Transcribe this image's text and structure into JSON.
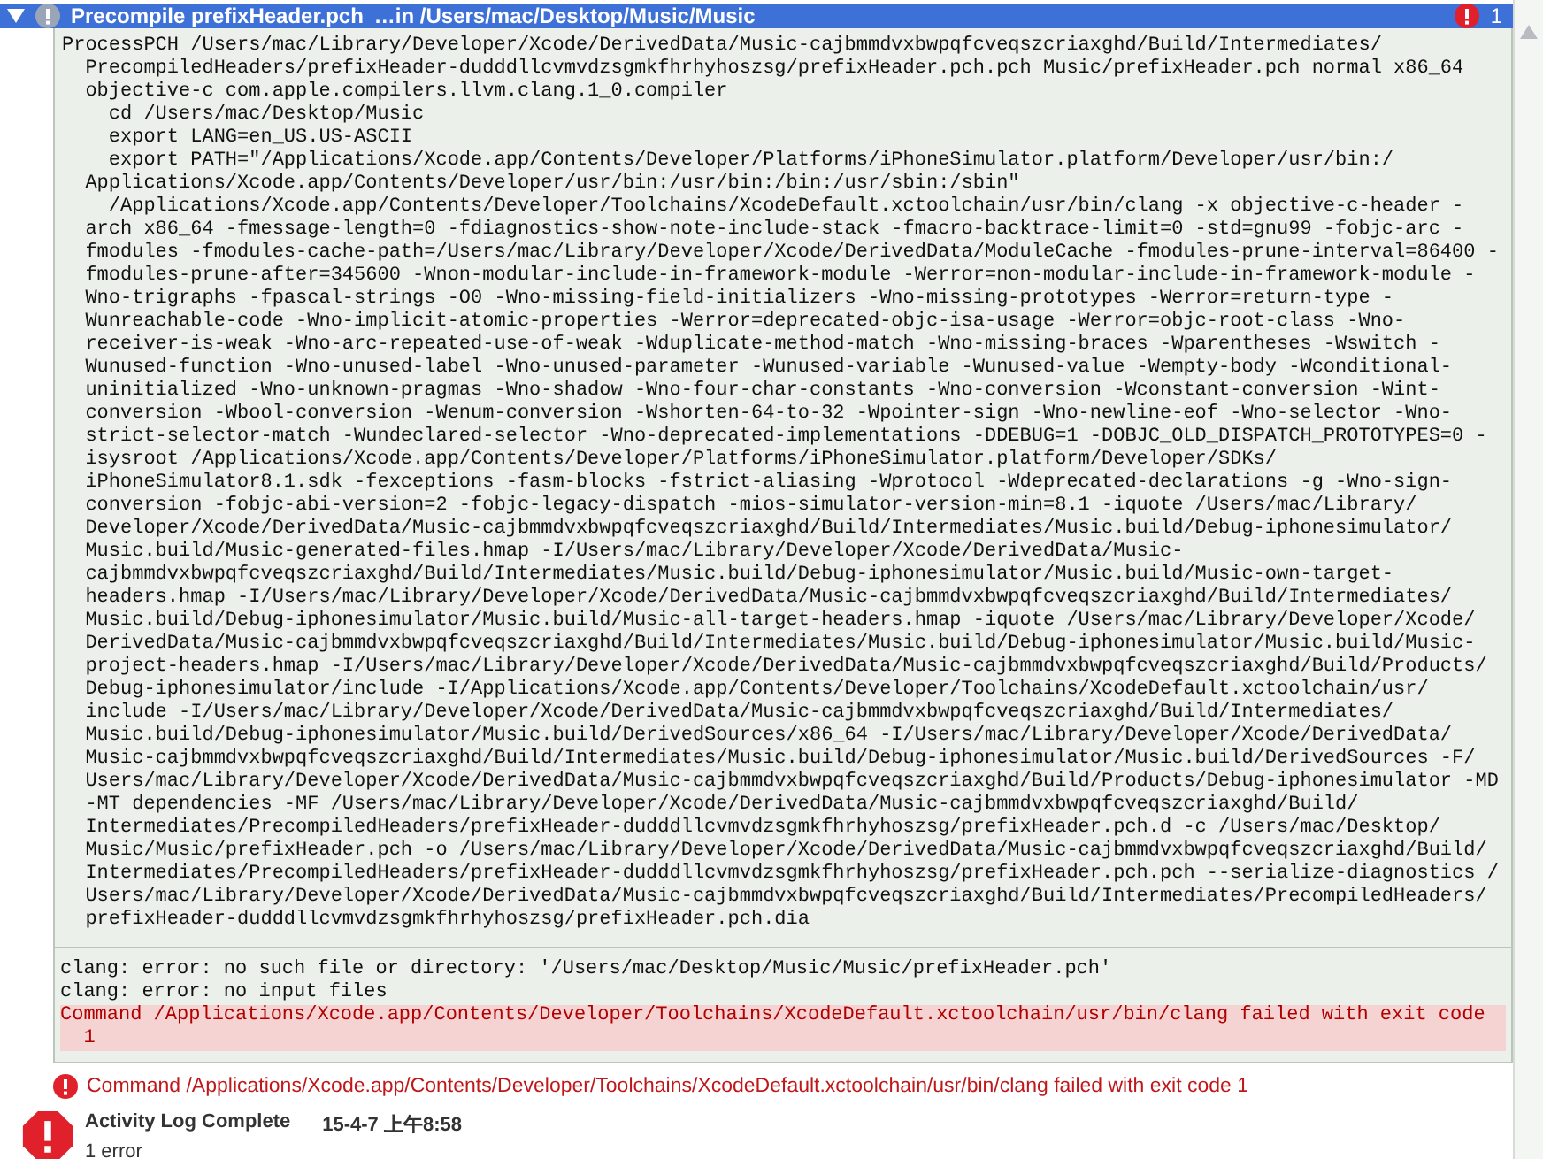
{
  "header": {
    "expanded": true,
    "title": "Precompile prefixHeader.pch",
    "subtitle": "…in /Users/mac/Desktop/Music/Music",
    "error_count": "1"
  },
  "log_lines": [
    "ProcessPCH /Users/mac/Library/Developer/Xcode/DerivedData/Music-cajbmmdvxbwpqfcveqszcriaxghd/Build/Intermediates/",
    "  PrecompiledHeaders/prefixHeader-dudddllcvmvdzsgmkfhrhyhoszsg/prefixHeader.pch.pch Music/prefixHeader.pch normal x86_64",
    "  objective-c com.apple.compilers.llvm.clang.1_0.compiler",
    "    cd /Users/mac/Desktop/Music",
    "    export LANG=en_US.US-ASCII",
    "    export PATH=\"/Applications/Xcode.app/Contents/Developer/Platforms/iPhoneSimulator.platform/Developer/usr/bin:/",
    "  Applications/Xcode.app/Contents/Developer/usr/bin:/usr/bin:/bin:/usr/sbin:/sbin\"",
    "    /Applications/Xcode.app/Contents/Developer/Toolchains/XcodeDefault.xctoolchain/usr/bin/clang -x objective-c-header -",
    "  arch x86_64 -fmessage-length=0 -fdiagnostics-show-note-include-stack -fmacro-backtrace-limit=0 -std=gnu99 -fobjc-arc -",
    "  fmodules -fmodules-cache-path=/Users/mac/Library/Developer/Xcode/DerivedData/ModuleCache -fmodules-prune-interval=86400 -",
    "  fmodules-prune-after=345600 -Wnon-modular-include-in-framework-module -Werror=non-modular-include-in-framework-module -",
    "  Wno-trigraphs -fpascal-strings -O0 -Wno-missing-field-initializers -Wno-missing-prototypes -Werror=return-type -",
    "  Wunreachable-code -Wno-implicit-atomic-properties -Werror=deprecated-objc-isa-usage -Werror=objc-root-class -Wno-",
    "  receiver-is-weak -Wno-arc-repeated-use-of-weak -Wduplicate-method-match -Wno-missing-braces -Wparentheses -Wswitch -",
    "  Wunused-function -Wno-unused-label -Wno-unused-parameter -Wunused-variable -Wunused-value -Wempty-body -Wconditional-",
    "  uninitialized -Wno-unknown-pragmas -Wno-shadow -Wno-four-char-constants -Wno-conversion -Wconstant-conversion -Wint-",
    "  conversion -Wbool-conversion -Wenum-conversion -Wshorten-64-to-32 -Wpointer-sign -Wno-newline-eof -Wno-selector -Wno-",
    "  strict-selector-match -Wundeclared-selector -Wno-deprecated-implementations -DDEBUG=1 -DOBJC_OLD_DISPATCH_PROTOTYPES=0 -",
    "  isysroot /Applications/Xcode.app/Contents/Developer/Platforms/iPhoneSimulator.platform/Developer/SDKs/",
    "  iPhoneSimulator8.1.sdk -fexceptions -fasm-blocks -fstrict-aliasing -Wprotocol -Wdeprecated-declarations -g -Wno-sign-",
    "  conversion -fobjc-abi-version=2 -fobjc-legacy-dispatch -mios-simulator-version-min=8.1 -iquote /Users/mac/Library/",
    "  Developer/Xcode/DerivedData/Music-cajbmmdvxbwpqfcveqszcriaxghd/Build/Intermediates/Music.build/Debug-iphonesimulator/",
    "  Music.build/Music-generated-files.hmap -I/Users/mac/Library/Developer/Xcode/DerivedData/Music-",
    "  cajbmmdvxbwpqfcveqszcriaxghd/Build/Intermediates/Music.build/Debug-iphonesimulator/Music.build/Music-own-target-",
    "  headers.hmap -I/Users/mac/Library/Developer/Xcode/DerivedData/Music-cajbmmdvxbwpqfcveqszcriaxghd/Build/Intermediates/",
    "  Music.build/Debug-iphonesimulator/Music.build/Music-all-target-headers.hmap -iquote /Users/mac/Library/Developer/Xcode/",
    "  DerivedData/Music-cajbmmdvxbwpqfcveqszcriaxghd/Build/Intermediates/Music.build/Debug-iphonesimulator/Music.build/Music-",
    "  project-headers.hmap -I/Users/mac/Library/Developer/Xcode/DerivedData/Music-cajbmmdvxbwpqfcveqszcriaxghd/Build/Products/",
    "  Debug-iphonesimulator/include -I/Applications/Xcode.app/Contents/Developer/Toolchains/XcodeDefault.xctoolchain/usr/",
    "  include -I/Users/mac/Library/Developer/Xcode/DerivedData/Music-cajbmmdvxbwpqfcveqszcriaxghd/Build/Intermediates/",
    "  Music.build/Debug-iphonesimulator/Music.build/DerivedSources/x86_64 -I/Users/mac/Library/Developer/Xcode/DerivedData/",
    "  Music-cajbmmdvxbwpqfcveqszcriaxghd/Build/Intermediates/Music.build/Debug-iphonesimulator/Music.build/DerivedSources -F/",
    "  Users/mac/Library/Developer/Xcode/DerivedData/Music-cajbmmdvxbwpqfcveqszcriaxghd/Build/Products/Debug-iphonesimulator -MD",
    "  -MT dependencies -MF /Users/mac/Library/Developer/Xcode/DerivedData/Music-cajbmmdvxbwpqfcveqszcriaxghd/Build/",
    "  Intermediates/PrecompiledHeaders/prefixHeader-dudddllcvmvdzsgmkfhrhyhoszsg/prefixHeader.pch.d -c /Users/mac/Desktop/",
    "  Music/Music/prefixHeader.pch -o /Users/mac/Library/Developer/Xcode/DerivedData/Music-cajbmmdvxbwpqfcveqszcriaxghd/Build/",
    "  Intermediates/PrecompiledHeaders/prefixHeader-dudddllcvmvdzsgmkfhrhyhoszsg/prefixHeader.pch.pch --serialize-diagnostics /",
    "  Users/mac/Library/Developer/Xcode/DerivedData/Music-cajbmmdvxbwpqfcveqszcriaxghd/Build/Intermediates/PrecompiledHeaders/",
    "  prefixHeader-dudddllcvmvdzsgmkfhrhyhoszsg/prefixHeader.pch.dia"
  ],
  "output_lines": [
    {
      "text": "clang: error: no such file or directory: '/Users/mac/Desktop/Music/Music/prefixHeader.pch'",
      "highlighted": false
    },
    {
      "text": "clang: error: no input files",
      "highlighted": false
    },
    {
      "text": "Command /Applications/Xcode.app/Contents/Developer/Toolchains/XcodeDefault.xctoolchain/usr/bin/clang failed with exit code\n  1",
      "highlighted": true
    }
  ],
  "issue": "Command /Applications/Xcode.app/Contents/Developer/Toolchains/XcodeDefault.xctoolchain/usr/bin/clang failed with exit code 1",
  "status": {
    "title": "Activity Log Complete",
    "time": "15-4-7 上午8:58",
    "detail": "1 error"
  }
}
